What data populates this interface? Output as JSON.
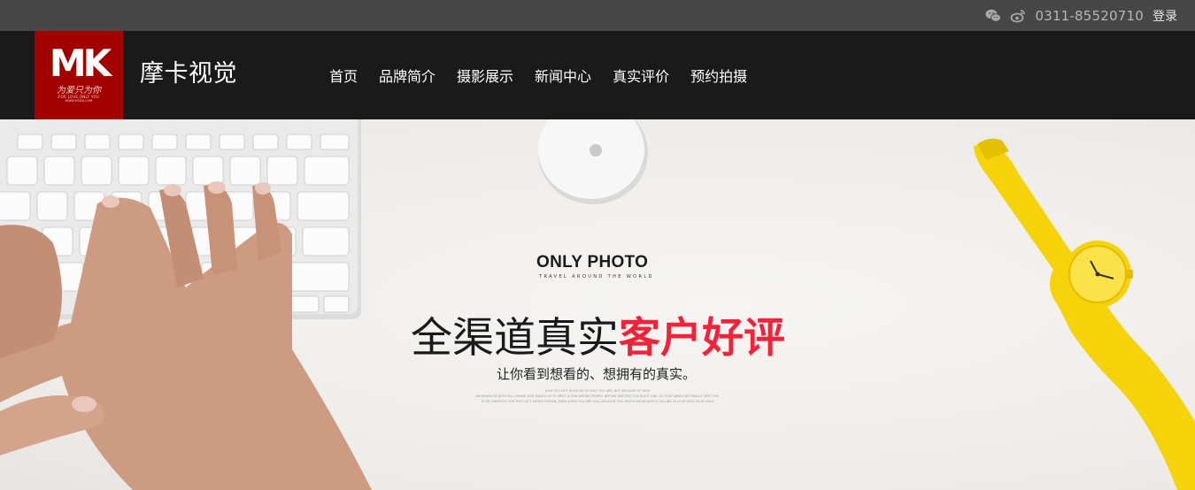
{
  "topbar": {
    "icons": [
      "wechat-icon",
      "weibo-icon"
    ],
    "phone": "0311-85520710",
    "login_label": "登录"
  },
  "header": {
    "logo": {
      "mark": "MK",
      "tagline": "为爱只为你",
      "small_en": "FOR LOVE,ONLY YOU",
      "small_url": "WWW.MOKA.COM"
    },
    "brand_name": "摩卡视觉",
    "nav": [
      "首页",
      "品牌简介",
      "摄影展示",
      "新闻中心",
      "真实评价",
      "预约拍摄"
    ]
  },
  "hero": {
    "logo_title": "ONLY PHOTO",
    "logo_subtitle": "TRAVEL AROUND THE WORLD",
    "headline_dark": "全渠道真实",
    "headline_red": "客户好评",
    "subheadline": "让你看到想看的、想拥有的真实。",
    "fine_print": [
      "LOVE YOU NOT BECAUSE OF WHO YOU ARE, BUT BECAUSE OF WHO",
      "AM WHEN I'M WITH YOU. MAYBE GOD WANTS US TO MEET A FEW WRONG PEOPLE BEFORE MEETING THE RIGHT ONE, SO THAT WHEN WE FINALLY MEET THE",
      "TO BE GRATEFUL FOR THAT GIFT. NEVER FROWN, EVEN WHEN YOU ARE SAD, BECAUSE YOU NEVER KNOW WHO IS FALLING IN LOVE WITH YOUR SMILE"
    ]
  },
  "colors": {
    "topbar_bg": "#474747",
    "header_bg": "#1a1a1a",
    "logo_bg": "#a30000",
    "accent_red": "#f0233a",
    "watch_yellow": "#f6d20a"
  }
}
